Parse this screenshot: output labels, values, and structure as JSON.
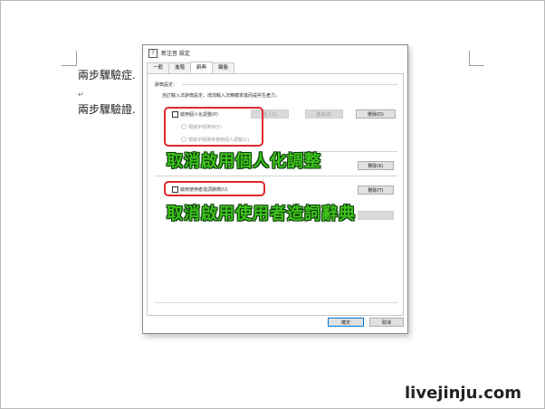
{
  "document": {
    "line1": "兩步驟驗症.",
    "line2": "兩步驟驗證.",
    "para_mark": "↵"
  },
  "dialog": {
    "title": "新注音 設定",
    "icon_glyph": "?",
    "tabs": [
      {
        "label": "一般",
        "active": false
      },
      {
        "label": "進階",
        "active": false
      },
      {
        "label": "辭典",
        "active": true
      },
      {
        "label": "鍵盤",
        "active": false
      }
    ],
    "section_title": "辭典設定：",
    "description": "自訂輸入法辭典設定，增加輸入法精確率進而提昇生產力。",
    "personal": {
      "checkbox_label": "啟用個人化調整(P)",
      "radio1": "根據字頻排序(F)",
      "radio2": "根據字頻排序使用個人調整(C)",
      "import_btn": "匯入(I)",
      "export_btn": "匯出(E)",
      "delete_btn": "刪除(D)"
    },
    "group2_delete_btn": "刪除(K)",
    "user_dict": {
      "checkbox_label": "啟用使用者造詞辭典(U)",
      "delete_btn": "刪除(T)"
    },
    "ok_btn": "確定",
    "cancel_btn": "取消"
  },
  "annotations": {
    "overlay1": "取消啟用個人化調整",
    "overlay2": "取消啟用使用者造詞辭典",
    "highlight_color": "#e0282e",
    "overlay_color": "#3ec21b"
  },
  "watermark": "livejinju.com"
}
